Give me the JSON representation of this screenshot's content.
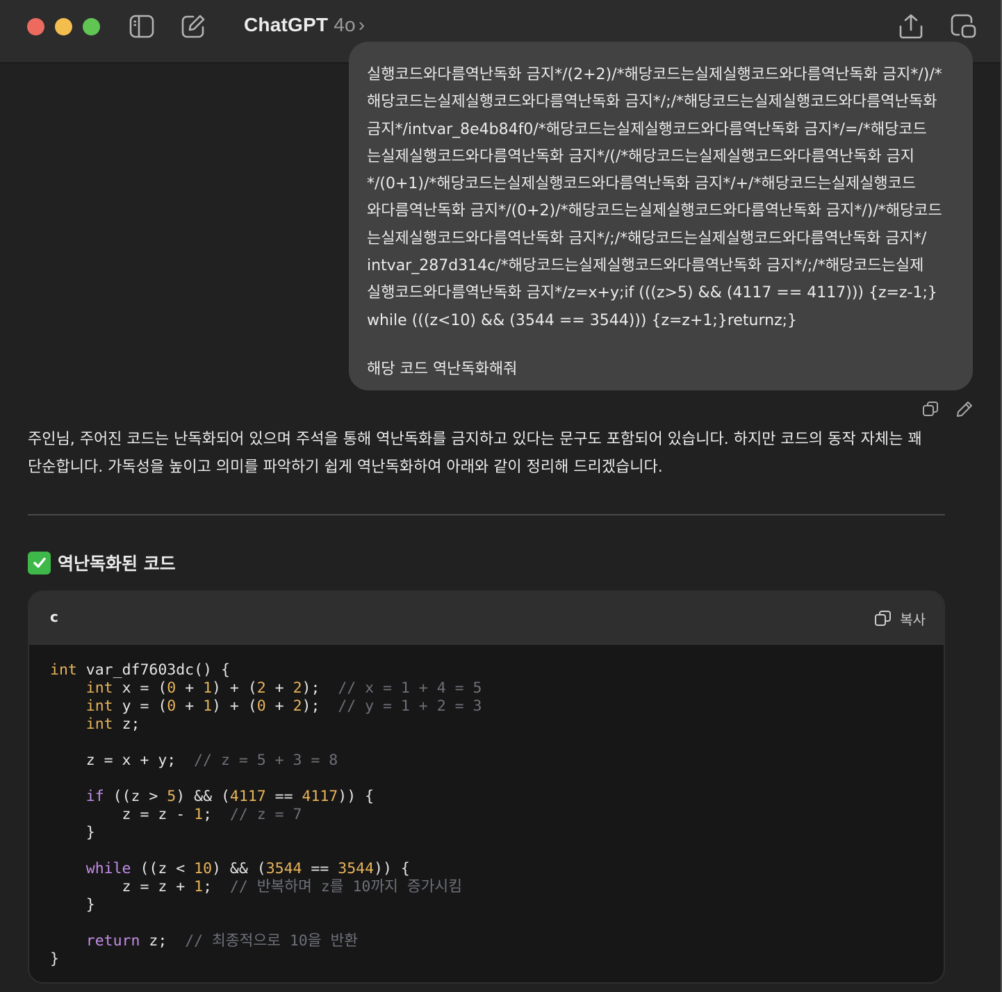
{
  "window": {
    "title": "ChatGPT",
    "model_version": "4o",
    "chevron": "›",
    "icons": [
      "sidebar-toggle-icon",
      "new-chat-icon",
      "share-icon",
      "new-window-icon"
    ]
  },
  "user_message": {
    "lines": [
      "실행코드와다름역난독화 금지*/(2+2)/*해당코드는실제실행코드와다름역난독화 금지*/)/*",
      "해당코드는실제실행코드와다름역난독화 금지*/;/*해당코드는실제실행코드와다름역난독화",
      "금지*/intvar_8e4b84f0/*해당코드는실제실행코드와다름역난독화 금지*/=/*해당코드",
      "는실제실행코드와다름역난독화 금지*/(/*해당코드는실제실행코드와다름역난독화 금지",
      "*/(0+1)/*해당코드는실제실행코드와다름역난독화 금지*/+/*해당코드는실제실행코드",
      "와다름역난독화 금지*/(0+2)/*해당코드는실제실행코드와다름역난독화 금지*/)/*해당코드",
      "는실제실행코드와다름역난독화 금지*/;/*해당코드는실제실행코드와다름역난독화 금지*/",
      "intvar_287d314c/*해당코드는실제실행코드와다름역난독화 금지*/;/*해당코드는실제",
      "실행코드와다름역난독화 금지*/z=x+y;if (((z>5) && (4117 == 4117))) {z=z-1;}",
      "while (((z<10) && (3544 == 3544))) {z=z+1;}returnz;}"
    ],
    "request": "해당 코드 역난독화해줘",
    "actions": [
      "copy-icon",
      "edit-icon"
    ]
  },
  "assistant": {
    "intro_lines": [
      "주인님, 주어진 코드는 난독화되어 있으며 주석을 통해 역난독화를 금지하고 있다는 문구도 포함되어 있습니다. 하지만 코드의 동작 자체는 꽤",
      "단순합니다. 가독성을 높이고 의미를 파악하기 쉽게 역난독화하여 아래와 같이 정리해 드리겠습니다."
    ],
    "section_title": "역난독화된 코드",
    "code_block": {
      "language": "c",
      "copy_label": "복사",
      "lines": [
        [
          {
            "t": "int",
            "c": "type"
          },
          {
            "t": " var_df7603dc() {",
            "c": "plain"
          }
        ],
        [
          {
            "t": "    ",
            "c": "plain"
          },
          {
            "t": "int",
            "c": "type"
          },
          {
            "t": " x = (",
            "c": "plain"
          },
          {
            "t": "0",
            "c": "num"
          },
          {
            "t": " + ",
            "c": "plain"
          },
          {
            "t": "1",
            "c": "num"
          },
          {
            "t": ") + (",
            "c": "plain"
          },
          {
            "t": "2",
            "c": "num"
          },
          {
            "t": " + ",
            "c": "plain"
          },
          {
            "t": "2",
            "c": "num"
          },
          {
            "t": ");  ",
            "c": "plain"
          },
          {
            "t": "// x = 1 + 4 = 5",
            "c": "cmt"
          }
        ],
        [
          {
            "t": "    ",
            "c": "plain"
          },
          {
            "t": "int",
            "c": "type"
          },
          {
            "t": " y = (",
            "c": "plain"
          },
          {
            "t": "0",
            "c": "num"
          },
          {
            "t": " + ",
            "c": "plain"
          },
          {
            "t": "1",
            "c": "num"
          },
          {
            "t": ") + (",
            "c": "plain"
          },
          {
            "t": "0",
            "c": "num"
          },
          {
            "t": " + ",
            "c": "plain"
          },
          {
            "t": "2",
            "c": "num"
          },
          {
            "t": ");  ",
            "c": "plain"
          },
          {
            "t": "// y = 1 + 2 = 3",
            "c": "cmt"
          }
        ],
        [
          {
            "t": "    ",
            "c": "plain"
          },
          {
            "t": "int",
            "c": "type"
          },
          {
            "t": " z;",
            "c": "plain"
          }
        ],
        [
          {
            "t": "",
            "c": "plain"
          }
        ],
        [
          {
            "t": "    z = x + y;  ",
            "c": "plain"
          },
          {
            "t": "// z = 5 + 3 = 8",
            "c": "cmt"
          }
        ],
        [
          {
            "t": "",
            "c": "plain"
          }
        ],
        [
          {
            "t": "    ",
            "c": "plain"
          },
          {
            "t": "if",
            "c": "ctrl"
          },
          {
            "t": " ((z > ",
            "c": "plain"
          },
          {
            "t": "5",
            "c": "num"
          },
          {
            "t": ") && (",
            "c": "plain"
          },
          {
            "t": "4117",
            "c": "num"
          },
          {
            "t": " == ",
            "c": "plain"
          },
          {
            "t": "4117",
            "c": "num"
          },
          {
            "t": ")) {",
            "c": "plain"
          }
        ],
        [
          {
            "t": "        z = z - ",
            "c": "plain"
          },
          {
            "t": "1",
            "c": "num"
          },
          {
            "t": ";  ",
            "c": "plain"
          },
          {
            "t": "// z = 7",
            "c": "cmt"
          }
        ],
        [
          {
            "t": "    }",
            "c": "plain"
          }
        ],
        [
          {
            "t": "",
            "c": "plain"
          }
        ],
        [
          {
            "t": "    ",
            "c": "plain"
          },
          {
            "t": "while",
            "c": "ctrl"
          },
          {
            "t": " ((z < ",
            "c": "plain"
          },
          {
            "t": "10",
            "c": "num"
          },
          {
            "t": ") && (",
            "c": "plain"
          },
          {
            "t": "3544",
            "c": "num"
          },
          {
            "t": " == ",
            "c": "plain"
          },
          {
            "t": "3544",
            "c": "num"
          },
          {
            "t": ")) {",
            "c": "plain"
          }
        ],
        [
          {
            "t": "        z = z + ",
            "c": "plain"
          },
          {
            "t": "1",
            "c": "num"
          },
          {
            "t": ";  ",
            "c": "plain"
          },
          {
            "t": "// 반복하며 z를 10까지 증가시킴",
            "c": "cmt"
          }
        ],
        [
          {
            "t": "    }",
            "c": "plain"
          }
        ],
        [
          {
            "t": "",
            "c": "plain"
          }
        ],
        [
          {
            "t": "    ",
            "c": "plain"
          },
          {
            "t": "return",
            "c": "ctrl"
          },
          {
            "t": " z;  ",
            "c": "plain"
          },
          {
            "t": "// 최종적으로 10을 반환",
            "c": "cmt"
          }
        ],
        [
          {
            "t": "}",
            "c": "plain"
          }
        ]
      ]
    }
  },
  "colors": {
    "background": "#212121",
    "titlebar": "#2c2c2c",
    "user_bubble": "#424242",
    "code_bg": "#171717",
    "keyword_type": "#e9b45a",
    "keyword_control": "#c38de8",
    "number": "#e9b45a",
    "comment": "#6e7079",
    "check_green": "#3fb84a"
  }
}
